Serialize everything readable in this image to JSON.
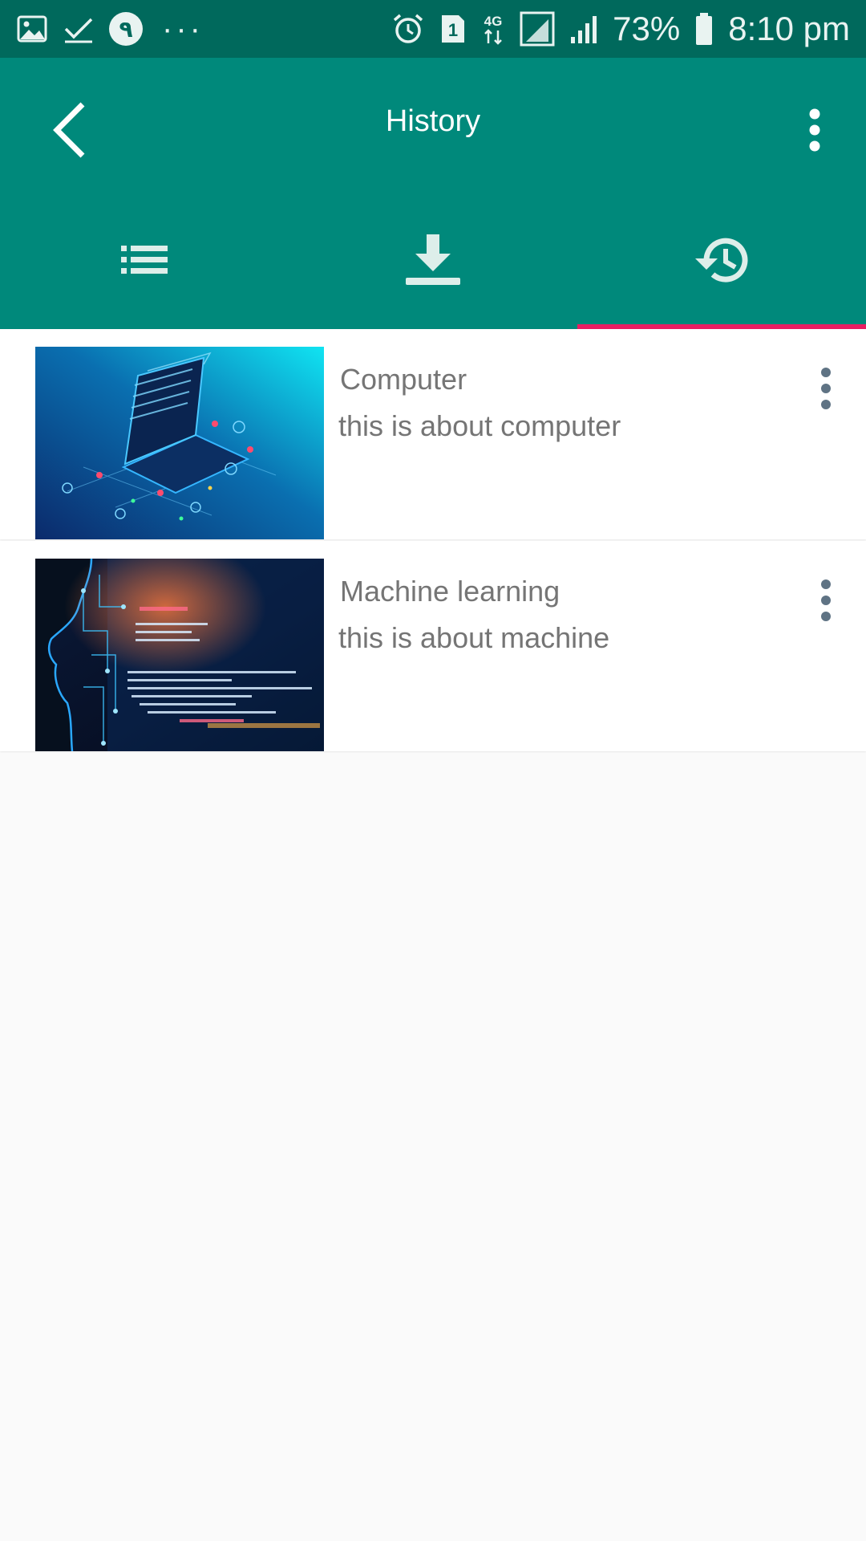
{
  "status_bar": {
    "left_icons": [
      "gallery-icon",
      "check-icon",
      "notification-badge-icon",
      "more-notifications-icon"
    ],
    "badge_text": "٩",
    "dots": "···",
    "sim_number": "1",
    "network": "4G",
    "battery": "73%",
    "time": "8:10 pm"
  },
  "app_bar": {
    "title": "History",
    "back_icon": "chevron-left-icon",
    "overflow_icon": "more-vertical-icon",
    "background": "#00897b",
    "status_bar_color": "#00695c"
  },
  "tabs": [
    {
      "icon": "list-icon",
      "selected": false
    },
    {
      "icon": "download-icon",
      "selected": false
    },
    {
      "icon": "history-icon",
      "selected": true
    }
  ],
  "accent_color": "#e91e63",
  "history_items": [
    {
      "title": "Computer",
      "description": "this is about computer",
      "thumbnail": "laptop-circuit-image"
    },
    {
      "title": "Machine learning",
      "description": "this is about machine",
      "thumbnail": "ai-head-code-image"
    }
  ]
}
